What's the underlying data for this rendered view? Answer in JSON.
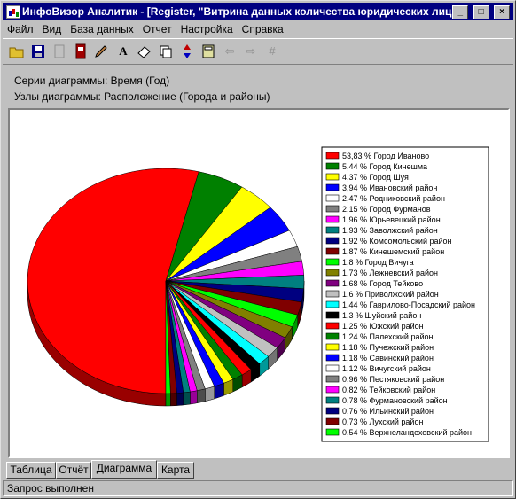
{
  "window": {
    "title": "ИнфоВизор Аналитик - [Register, \"Витрина данных количества юридических лиц\"]",
    "minimize_icon": "minimize-icon",
    "maximize_icon": "maximize-icon",
    "close_icon": "close-icon"
  },
  "menu": [
    "Файл",
    "Вид",
    "База данных",
    "Отчет",
    "Настройка",
    "Справка"
  ],
  "toolbar": {
    "icons": [
      "open-folder-icon",
      "save-icon",
      "document-disabled-icon",
      "exit-door-icon",
      "edit-pen-icon",
      "font-icon",
      "eraser-icon",
      "copy-icon",
      "sort-arrows-icon",
      "calculator-icon",
      "arrow-left-disabled-icon",
      "arrow-right-disabled-icon",
      "grid-disabled-icon"
    ],
    "font_glyph": "A"
  },
  "info": {
    "series": "Серии диаграммы: Время (Год)",
    "nodes": "Узлы диаграммы: Расположение (Города и районы)"
  },
  "chart_data": {
    "type": "pie",
    "unit": "%",
    "slices": [
      {
        "label": "Город Иваново",
        "value": 53.83,
        "text": "53,83",
        "color": "#ff0000"
      },
      {
        "label": "Город Кинешма",
        "value": 5.44,
        "text": "5,44",
        "color": "#008000"
      },
      {
        "label": "Город Шуя",
        "value": 4.37,
        "text": "4,37",
        "color": "#ffff00"
      },
      {
        "label": "Ивановский район",
        "value": 3.94,
        "text": "3,94",
        "color": "#0000ff"
      },
      {
        "label": "Родниковский район",
        "value": 2.47,
        "text": "2,47",
        "color": "#ffffff"
      },
      {
        "label": "Город Фурманов",
        "value": 2.15,
        "text": "2,15",
        "color": "#808080"
      },
      {
        "label": "Юрьевецкий район",
        "value": 1.96,
        "text": "1,96",
        "color": "#ff00ff"
      },
      {
        "label": "Заволжский район",
        "value": 1.93,
        "text": "1,93",
        "color": "#008080"
      },
      {
        "label": "Комсомольский район",
        "value": 1.92,
        "text": "1,92",
        "color": "#000080"
      },
      {
        "label": "Кинешемский район",
        "value": 1.87,
        "text": "1,87",
        "color": "#800000"
      },
      {
        "label": "Город Вичуга",
        "value": 1.8,
        "text": "1,8",
        "color": "#00ff00"
      },
      {
        "label": "Лежневский район",
        "value": 1.73,
        "text": "1,73",
        "color": "#808000"
      },
      {
        "label": "Город Тейково",
        "value": 1.68,
        "text": "1,68",
        "color": "#800080"
      },
      {
        "label": "Приволжский район",
        "value": 1.6,
        "text": "1,6",
        "color": "#c0c0c0"
      },
      {
        "label": "Гаврилово-Посадский район",
        "value": 1.44,
        "text": "1,44",
        "color": "#00ffff"
      },
      {
        "label": "Шуйский район",
        "value": 1.3,
        "text": "1,3",
        "color": "#000000"
      },
      {
        "label": "Южский район",
        "value": 1.25,
        "text": "1,25",
        "color": "#ff0000"
      },
      {
        "label": "Палехский район",
        "value": 1.24,
        "text": "1,24",
        "color": "#008000"
      },
      {
        "label": "Пучежский район",
        "value": 1.18,
        "text": "1,18",
        "color": "#ffff00"
      },
      {
        "label": "Савинский район",
        "value": 1.18,
        "text": "1,18",
        "color": "#0000ff"
      },
      {
        "label": "Вичугский район",
        "value": 1.12,
        "text": "1,12",
        "color": "#ffffff"
      },
      {
        "label": "Пестяковский район",
        "value": 0.96,
        "text": "0,96",
        "color": "#808080"
      },
      {
        "label": "Тейковский район",
        "value": 0.82,
        "text": "0,82",
        "color": "#ff00ff"
      },
      {
        "label": "Фурмановский район",
        "value": 0.78,
        "text": "0,78",
        "color": "#008080"
      },
      {
        "label": "Ильинский район",
        "value": 0.76,
        "text": "0,76",
        "color": "#000080"
      },
      {
        "label": "Лухский район",
        "value": 0.73,
        "text": "0,73",
        "color": "#800000"
      },
      {
        "label": "Верхнеландеховский район",
        "value": 0.54,
        "text": "0,54",
        "color": "#00ff00"
      }
    ],
    "legend_position": "right"
  },
  "tabs": [
    "Таблица",
    "Отчёт",
    "Диаграмма",
    "Карта"
  ],
  "active_tab": "Диаграмма",
  "status": "Запрос выполнен"
}
